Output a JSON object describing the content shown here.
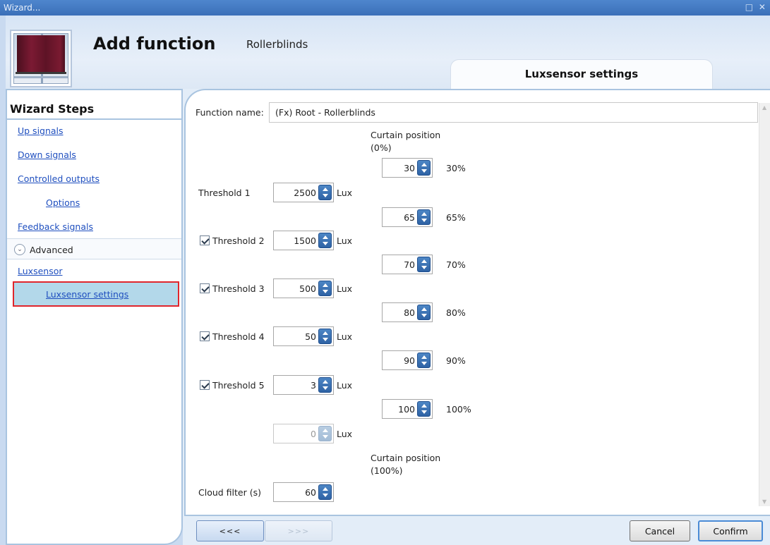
{
  "window": {
    "title": "Wizard...",
    "controls": "□ ✕"
  },
  "header": {
    "title": "Add function",
    "subtitle": "Rollerblinds",
    "tab": "Luxsensor settings",
    "image_icon": "rollerblind-window-icon"
  },
  "sidebar": {
    "title": "Wizard Steps",
    "items": [
      {
        "label": "Up signals"
      },
      {
        "label": "Down signals"
      },
      {
        "label": "Controlled outputs"
      },
      {
        "label": "Options"
      },
      {
        "label": "Feedback signals"
      }
    ],
    "advanced": {
      "label": "Advanced",
      "icon": "chevron-down-circle-icon"
    },
    "luxsensor": "Luxsensor",
    "selected": "Luxsensor settings"
  },
  "form": {
    "function_name_label": "Function name:",
    "function_name_value": "(Fx) Root - Rollerblinds",
    "curtain_top_line1": "Curtain position",
    "curtain_top_line2": "(0%)",
    "curtain_bottom_line1": "Curtain position",
    "curtain_bottom_line2": "(100%)",
    "lux_unit": "Lux",
    "positions": [
      {
        "value": "30",
        "pct": "30%"
      },
      {
        "value": "65",
        "pct": "65%"
      },
      {
        "value": "70",
        "pct": "70%"
      },
      {
        "value": "80",
        "pct": "80%"
      },
      {
        "value": "90",
        "pct": "90%"
      },
      {
        "value": "100",
        "pct": "100%"
      }
    ],
    "thresholds": [
      {
        "label": "Threshold 1",
        "value": "2500",
        "checkbox": false
      },
      {
        "label": "Threshold 2",
        "value": "1500",
        "checkbox": true,
        "checked": true
      },
      {
        "label": "Threshold 3",
        "value": "500",
        "checkbox": true,
        "checked": true
      },
      {
        "label": "Threshold 4",
        "value": "50",
        "checkbox": true,
        "checked": true
      },
      {
        "label": "Threshold 5",
        "value": "3",
        "checkbox": true,
        "checked": true
      }
    ],
    "extra_lux_value": "0",
    "cloud_filter_label": "Cloud filter (s)",
    "cloud_filter_value": "60"
  },
  "footer": {
    "back": "<<<",
    "next": ">>>",
    "cancel": "Cancel",
    "confirm": "Confirm"
  }
}
